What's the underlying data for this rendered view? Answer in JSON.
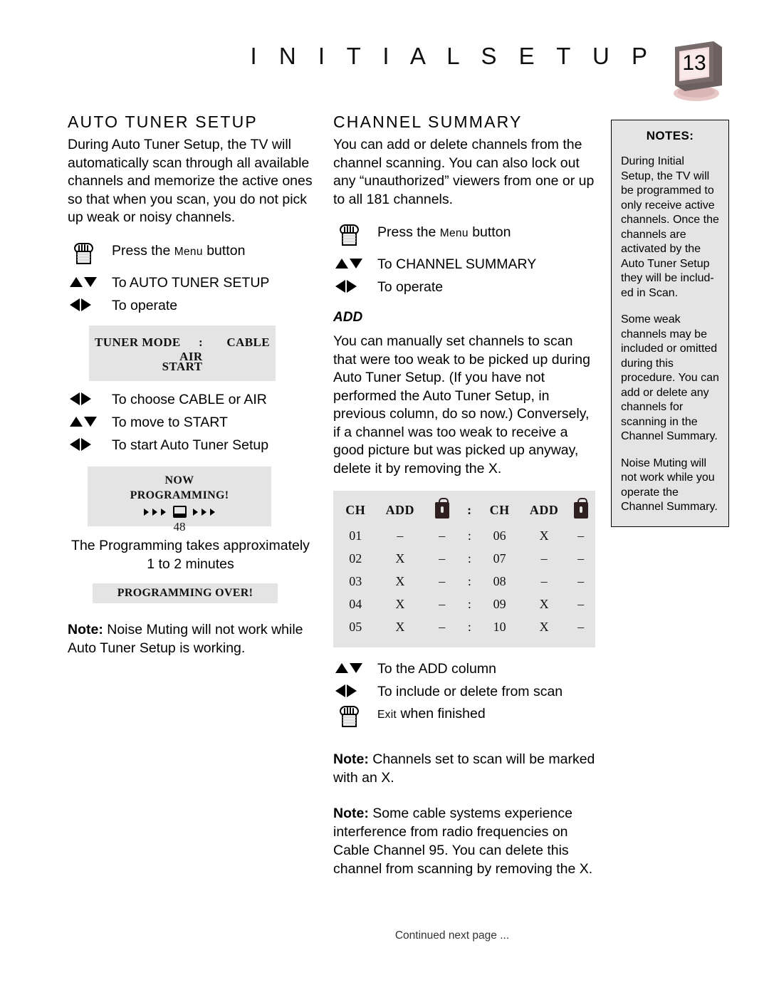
{
  "header": {
    "title": "I N I T I A L   S E T U P",
    "page_number": "13",
    "tv_icon": "tv-icon"
  },
  "left_column": {
    "heading": "AUTO TUNER SETUP",
    "intro": "During Auto Tuner Setup, the TV will automatically scan through all available channels and memorize the active ones so that when you scan, you do not pick up weak or noisy channels.",
    "steps_a": [
      {
        "icon": "menu-button-icon",
        "label_pre": "Press the ",
        "label_sc": "Menu",
        "label_post": " button"
      },
      {
        "icon": "up-down-arrows-icon",
        "label": "To AUTO TUNER SETUP"
      },
      {
        "icon": "left-right-arrows-icon",
        "label": "To operate"
      }
    ],
    "osd_tuner": {
      "label": "TUNER MODE",
      "colon": ":",
      "option_cable": "CABLE",
      "option_air": "AIR",
      "start": "START"
    },
    "steps_b": [
      {
        "icon": "left-right-arrows-icon",
        "label": "To choose CABLE or AIR"
      },
      {
        "icon": "up-down-arrows-icon",
        "label": "To move to START"
      },
      {
        "icon": "left-right-arrows-icon",
        "label": "To start Auto Tuner Setup"
      }
    ],
    "osd_now": {
      "line1": "NOW",
      "line2": "PROGRAMMING!",
      "channel": "48"
    },
    "takes_line1": "The Programming takes approximately",
    "takes_line2": "1 to 2 minutes",
    "osd_over": "PROGRAMMING OVER!",
    "note": {
      "label": "Note:",
      "text": " Noise Muting will not work while Auto Tuner Setup is working."
    }
  },
  "mid_column": {
    "heading": "CHANNEL SUMMARY",
    "intro": "You can add or delete channels from the channel scanning. You can also lock out any “unauthorized” viewers from one or up to all 181 channels.",
    "steps_a": [
      {
        "icon": "menu-button-icon",
        "label_pre": "Press the ",
        "label_sc": "Menu",
        "label_post": " button"
      },
      {
        "icon": "up-down-arrows-icon",
        "label": "To CHANNEL SUMMARY"
      },
      {
        "icon": "left-right-arrows-icon",
        "label": "To operate"
      }
    ],
    "add_heading": "ADD",
    "add_text": "You can manually set channels to scan that were too weak to be picked up during Auto Tuner Setup. (If you have not performed the Auto Tuner Setup, in previous column, do so now.) Conversely, if a channel was too weak to receive a good picture but was picked up anyway, delete it by removing the X.",
    "channel_table": {
      "headers": [
        "CH",
        "ADD",
        "lock-icon",
        ":",
        "CH",
        "ADD",
        "lock-icon"
      ],
      "rows": [
        [
          "01",
          "–",
          "–",
          ":",
          "06",
          "X",
          "–"
        ],
        [
          "02",
          "X",
          "–",
          ":",
          "07",
          "–",
          "–"
        ],
        [
          "03",
          "X",
          "–",
          ":",
          "08",
          "–",
          "–"
        ],
        [
          "04",
          "X",
          "–",
          ":",
          "09",
          "X",
          "–"
        ],
        [
          "05",
          "X",
          "–",
          ":",
          "10",
          "X",
          "–"
        ]
      ]
    },
    "steps_b": [
      {
        "icon": "up-down-arrows-icon",
        "label": "To the ADD column"
      },
      {
        "icon": "left-right-arrows-icon",
        "label": "To include or delete from scan"
      },
      {
        "icon": "exit-button-icon",
        "label_pre": "",
        "label_sc": "Exit",
        "label_post": " when finished"
      }
    ],
    "note1": {
      "label": "Note:",
      "text": " Channels set to scan will be marked with an X."
    },
    "note2": {
      "label": "Note:",
      "text": " Some cable systems experience interference from radio frequencies on Cable Channel 95. You can delete this channel from scanning by removing the X."
    }
  },
  "notes_sidebar": {
    "title": "NOTES:",
    "paragraphs": [
      "During Initial Setup, the TV will be programmed to only receive active channels. Once the channels are activated by the Auto Tuner Setup they will be includ-ed in Scan.",
      "Some weak channels may be included or omitted during this procedure. You can add or delete any channels for scanning in the Channel Summary.",
      "Noise Muting will not work while you operate the Channel Summary."
    ]
  },
  "footer": {
    "text": "Continued next page ..."
  },
  "colors": {
    "osd_background": "#e4e4e4",
    "tv_screen": "#f2d5d5",
    "tv_body": "#5a5050",
    "lock": "#2e2020"
  }
}
